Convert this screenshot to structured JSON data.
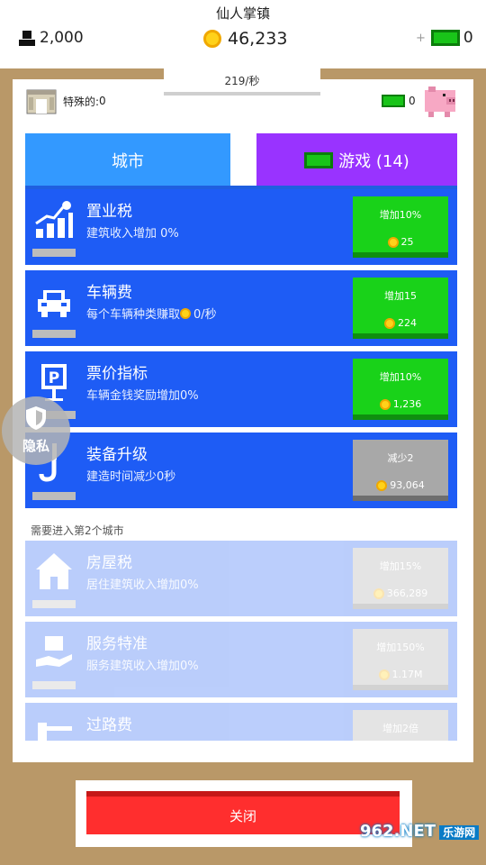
{
  "header": {
    "title": "仙人掌镇",
    "population": "2,000",
    "money": "46,233",
    "plus": "+",
    "gems": "0"
  },
  "rate": "219/秒",
  "info": {
    "special_label": "特殊的:",
    "special_value": "0",
    "piggy_value": "0"
  },
  "tabs": {
    "city": "城市",
    "game": "游戏 (14)"
  },
  "upgrades": [
    {
      "title": "置业税",
      "desc": "建筑收入增加 0%",
      "btn_label": "增加10%",
      "cost": "25",
      "icon": "growth-chart-icon"
    },
    {
      "title": "车辆费",
      "desc_pre": "每个车辆种类赚取",
      "desc_post": "0/秒",
      "btn_label": "增加15",
      "cost": "224",
      "icon": "car-icon"
    },
    {
      "title": "票价指标",
      "desc": "车辆金钱奖励增加0%",
      "btn_label": "增加10%",
      "cost": "1,236",
      "icon": "parking-sign-icon"
    },
    {
      "title": "装备升级",
      "desc": "建造时间减少0秒",
      "btn_label": "减少2",
      "cost": "93,064",
      "icon": "crane-hook-icon"
    }
  ],
  "lock_note": "需要进入第2个城市",
  "locked_upgrades": [
    {
      "title": "房屋税",
      "desc": "居住建筑收入增加0%",
      "btn_label": "增加15%",
      "cost": "366,289",
      "icon": "house-icon"
    },
    {
      "title": "服务特准",
      "desc": "服务建筑收入增加0%",
      "btn_label": "增加150%",
      "cost": "1.17M",
      "icon": "service-hand-icon"
    },
    {
      "title": "过路费",
      "desc": "",
      "btn_label": "增加2倍",
      "cost": "",
      "icon": "toll-gate-icon"
    }
  ],
  "privacy_label": "隐私",
  "close_label": "关闭",
  "watermark": {
    "main": "962.NET",
    "sub": "乐游网"
  },
  "colors": {
    "blue_card": "#1e5cf5",
    "tab_city": "#3399ff",
    "tab_game": "#9933ff",
    "buy_green": "#19d219",
    "close_red": "#ff2e2e",
    "wood": "#b99868"
  }
}
